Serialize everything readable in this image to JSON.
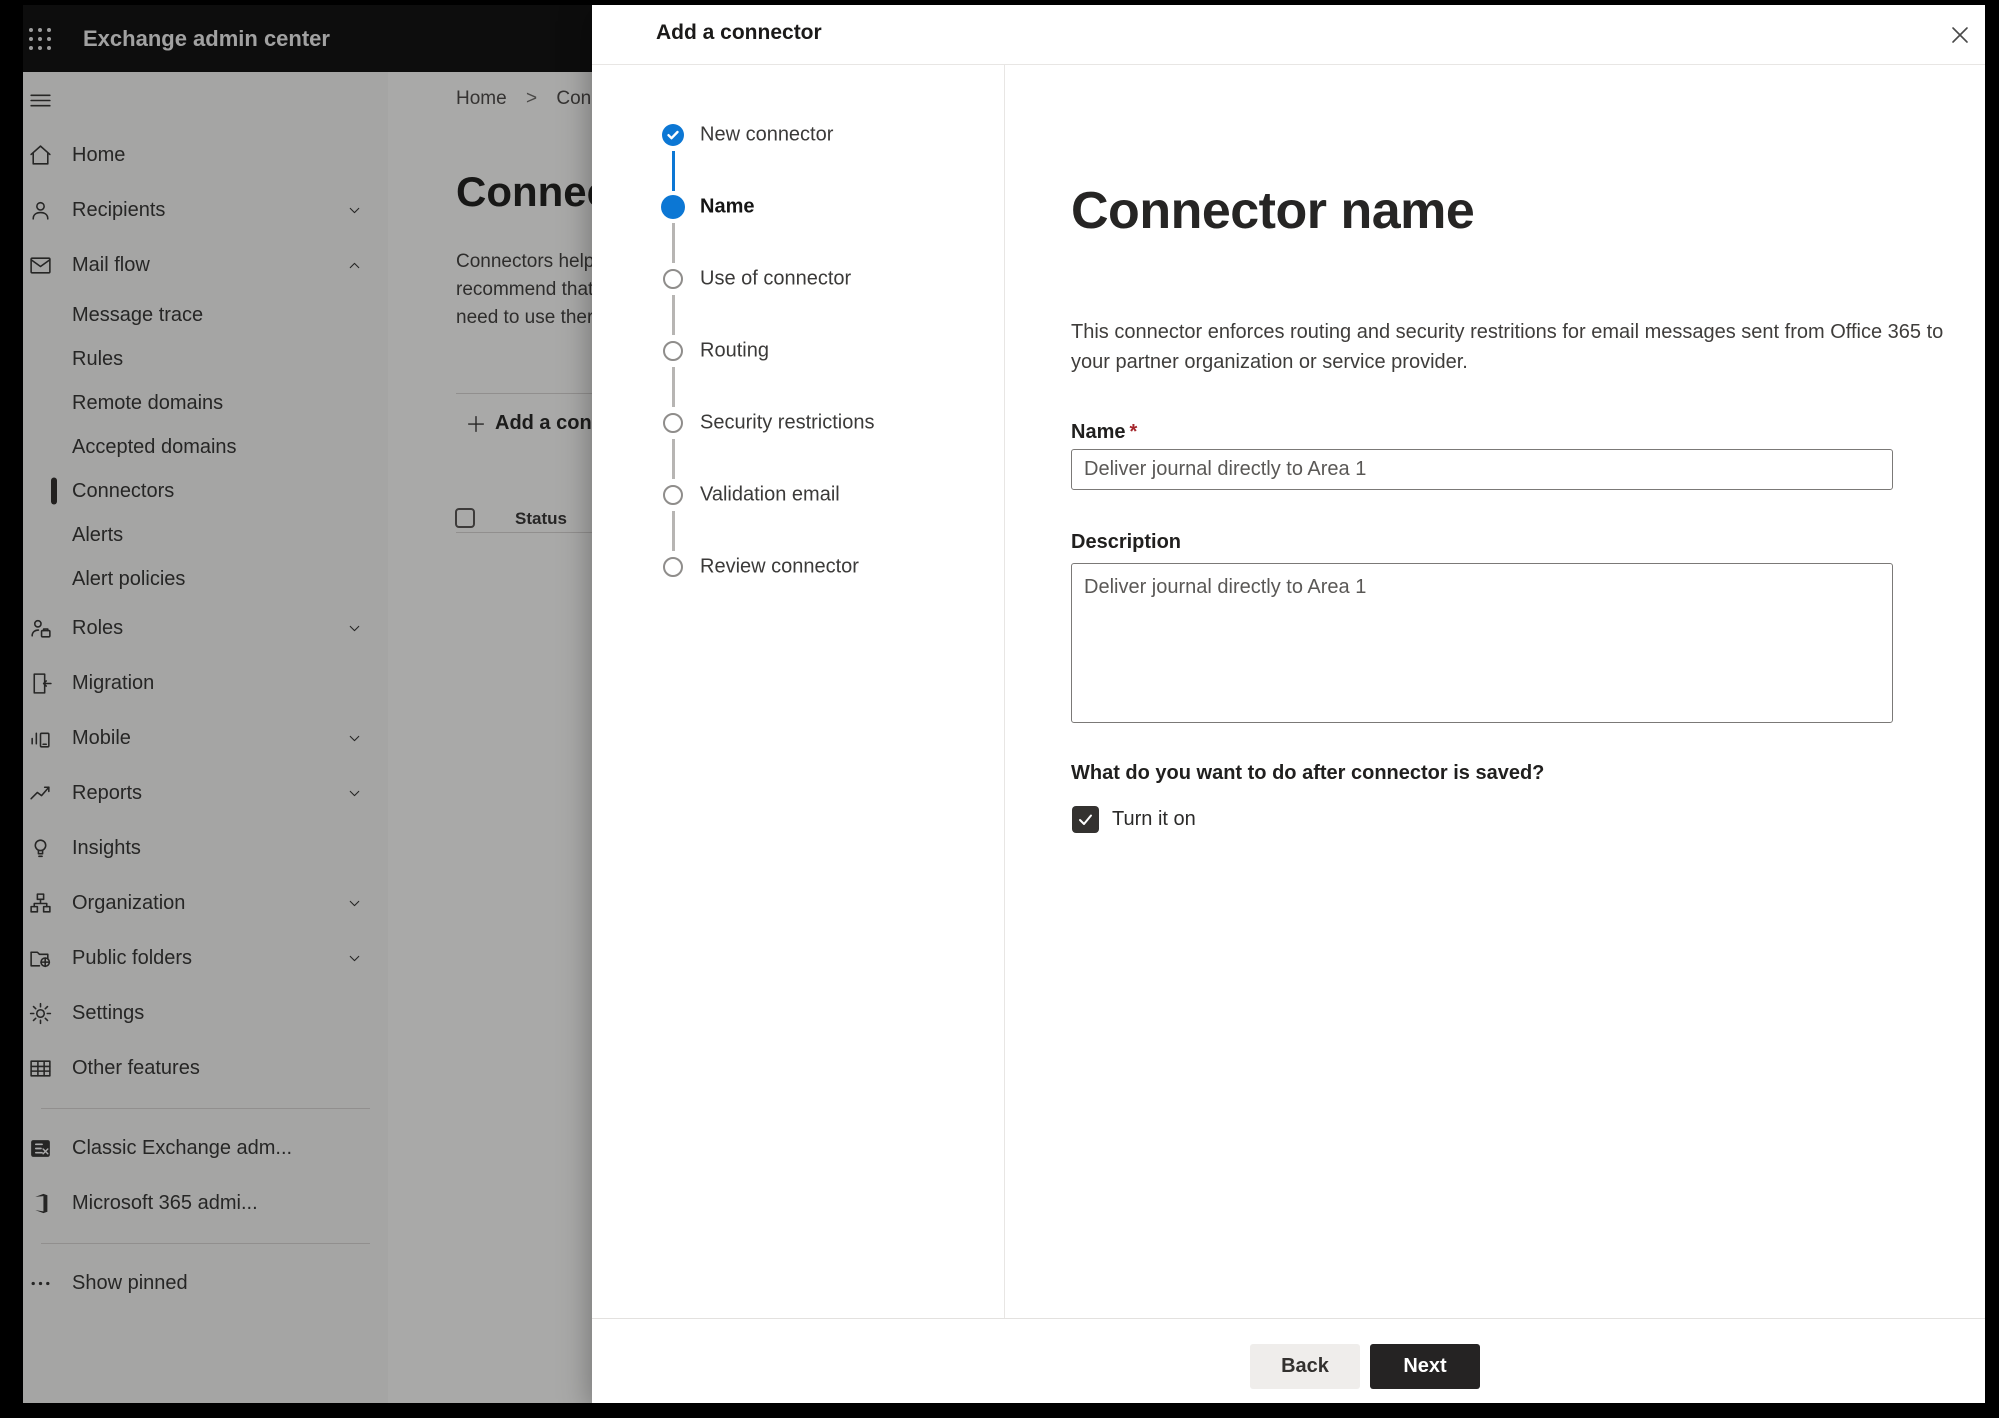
{
  "app": {
    "title": "Exchange admin center"
  },
  "colors": {
    "accent": "#0c77d4",
    "next_button": "#252323",
    "back_button": "#efedeb",
    "checkbox": "#343230",
    "required": "#a4262c"
  },
  "sidebar": {
    "items": [
      {
        "label": "Home"
      },
      {
        "label": "Recipients"
      },
      {
        "label": "Mail flow"
      },
      {
        "label": "Message trace"
      },
      {
        "label": "Rules"
      },
      {
        "label": "Remote domains"
      },
      {
        "label": "Accepted domains"
      },
      {
        "label": "Connectors"
      },
      {
        "label": "Alerts"
      },
      {
        "label": "Alert policies"
      },
      {
        "label": "Roles"
      },
      {
        "label": "Migration"
      },
      {
        "label": "Mobile"
      },
      {
        "label": "Reports"
      },
      {
        "label": "Insights"
      },
      {
        "label": "Organization"
      },
      {
        "label": "Public folders"
      },
      {
        "label": "Settings"
      },
      {
        "label": "Other features"
      },
      {
        "label": "Classic Exchange adm..."
      },
      {
        "label": "Microsoft 365 admi..."
      },
      {
        "label": "Show pinned"
      }
    ]
  },
  "background": {
    "breadcrumb": {
      "home": "Home",
      "separator": ">",
      "current": "Conne"
    },
    "page_title": "Connect",
    "intro_lines": {
      "l1": "Connectors help",
      "l2": "recommend that",
      "l3": "need to use ther"
    },
    "add_button": "Add a conn",
    "table": {
      "status_header": "Status"
    }
  },
  "dialog": {
    "title": "Add a connector",
    "steps": [
      {
        "label": "New connector",
        "state": "completed"
      },
      {
        "label": "Name",
        "state": "current"
      },
      {
        "label": "Use of connector",
        "state": "upcoming"
      },
      {
        "label": "Routing",
        "state": "upcoming"
      },
      {
        "label": "Security restrictions",
        "state": "upcoming"
      },
      {
        "label": "Validation email",
        "state": "upcoming"
      },
      {
        "label": "Review connector",
        "state": "upcoming"
      }
    ],
    "heading": "Connector name",
    "intro": "This connector enforces routing and security restritions for email messages sent from Office 365 to your partner organization or service provider.",
    "name_field": {
      "label": "Name",
      "required_mark": "*",
      "value": "Deliver journal directly to Area 1"
    },
    "description_field": {
      "label": "Description",
      "value": "Deliver journal directly to Area 1"
    },
    "after_save": {
      "question": "What do you want to do after connector is saved?",
      "checkbox_label": "Turn it on",
      "checked": true
    },
    "footer": {
      "back": "Back",
      "next": "Next"
    }
  }
}
